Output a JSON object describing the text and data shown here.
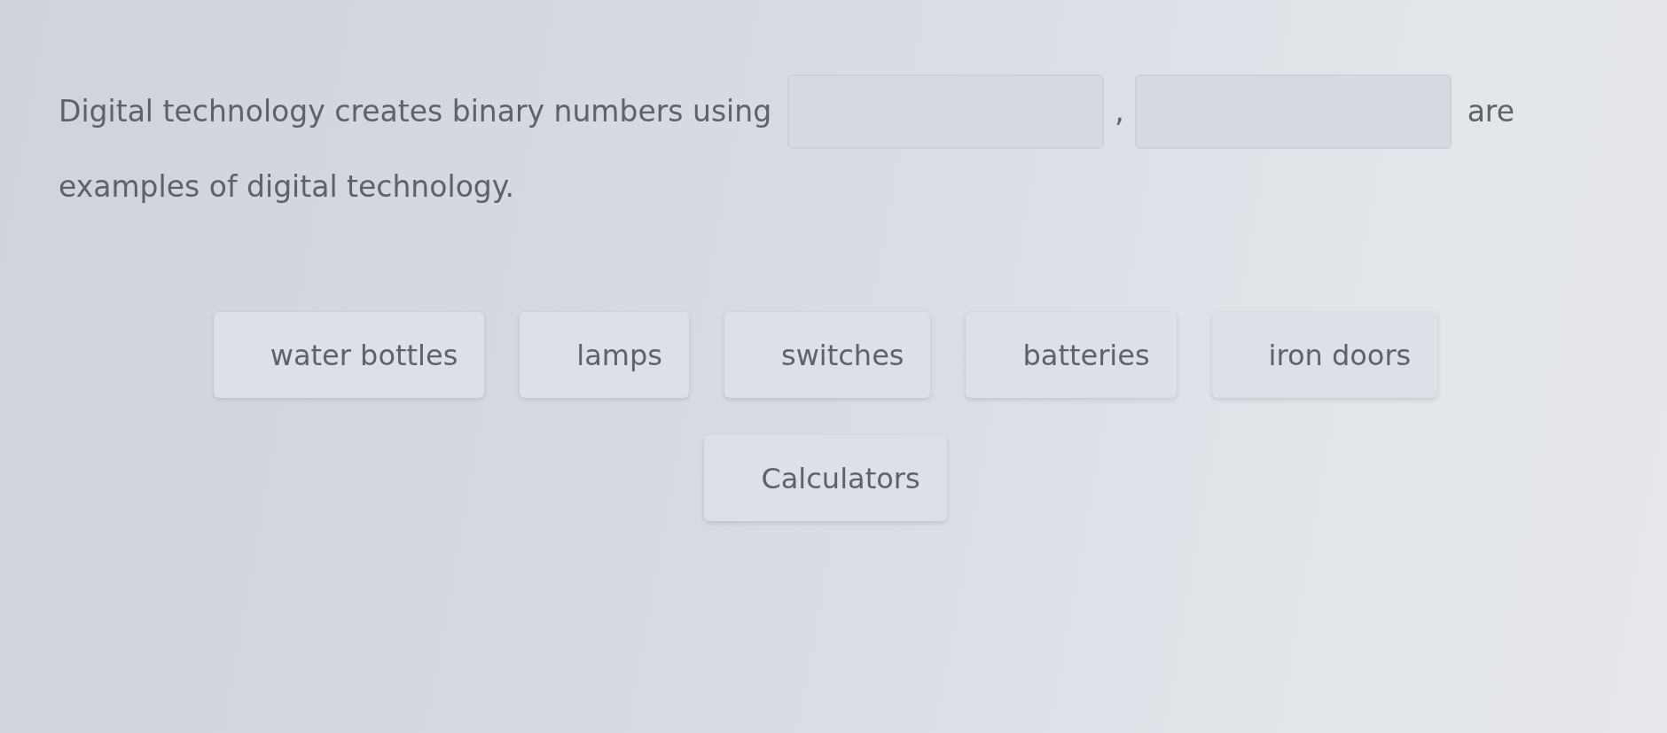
{
  "sentence": [
    {
      "kind": "text",
      "text": "Digital technology creates binary numbers using"
    },
    {
      "kind": "blank"
    },
    {
      "kind": "text",
      "text": ","
    },
    {
      "kind": "blank"
    },
    {
      "kind": "text",
      "text": "are"
    },
    {
      "kind": "text",
      "text": "examples of digital technology."
    }
  ],
  "options": [
    "water bottles",
    "lamps",
    "switches",
    "batteries",
    "iron doors",
    "Calculators"
  ]
}
